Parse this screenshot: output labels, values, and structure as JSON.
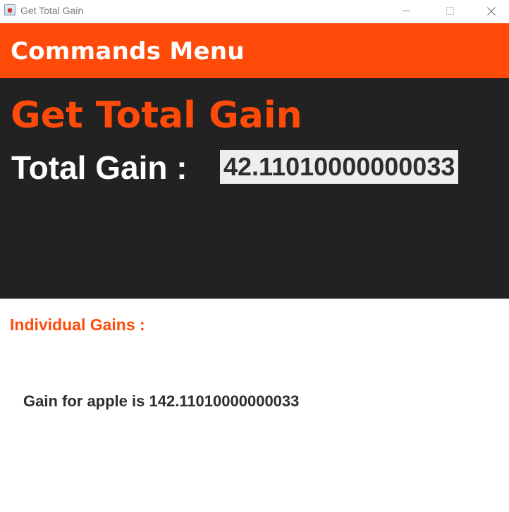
{
  "window": {
    "title": "Get Total Gain",
    "controls": {
      "minimize_icon": "minimize-icon",
      "maximize_icon": "maximize-icon",
      "close_icon": "close-icon"
    }
  },
  "header": {
    "title": "Commands Menu",
    "background_color": "#ff4a0a",
    "text_color": "#ffffff"
  },
  "main": {
    "heading": "Get Total Gain",
    "total_label": "Total Gain :",
    "total_value": "42.11010000000033",
    "panel_color": "#222222",
    "accent_color": "#ff4a0a"
  },
  "individual": {
    "heading": "Individual Gains :",
    "items": [
      {
        "text": "Gain for apple is 142.11010000000033"
      }
    ]
  }
}
